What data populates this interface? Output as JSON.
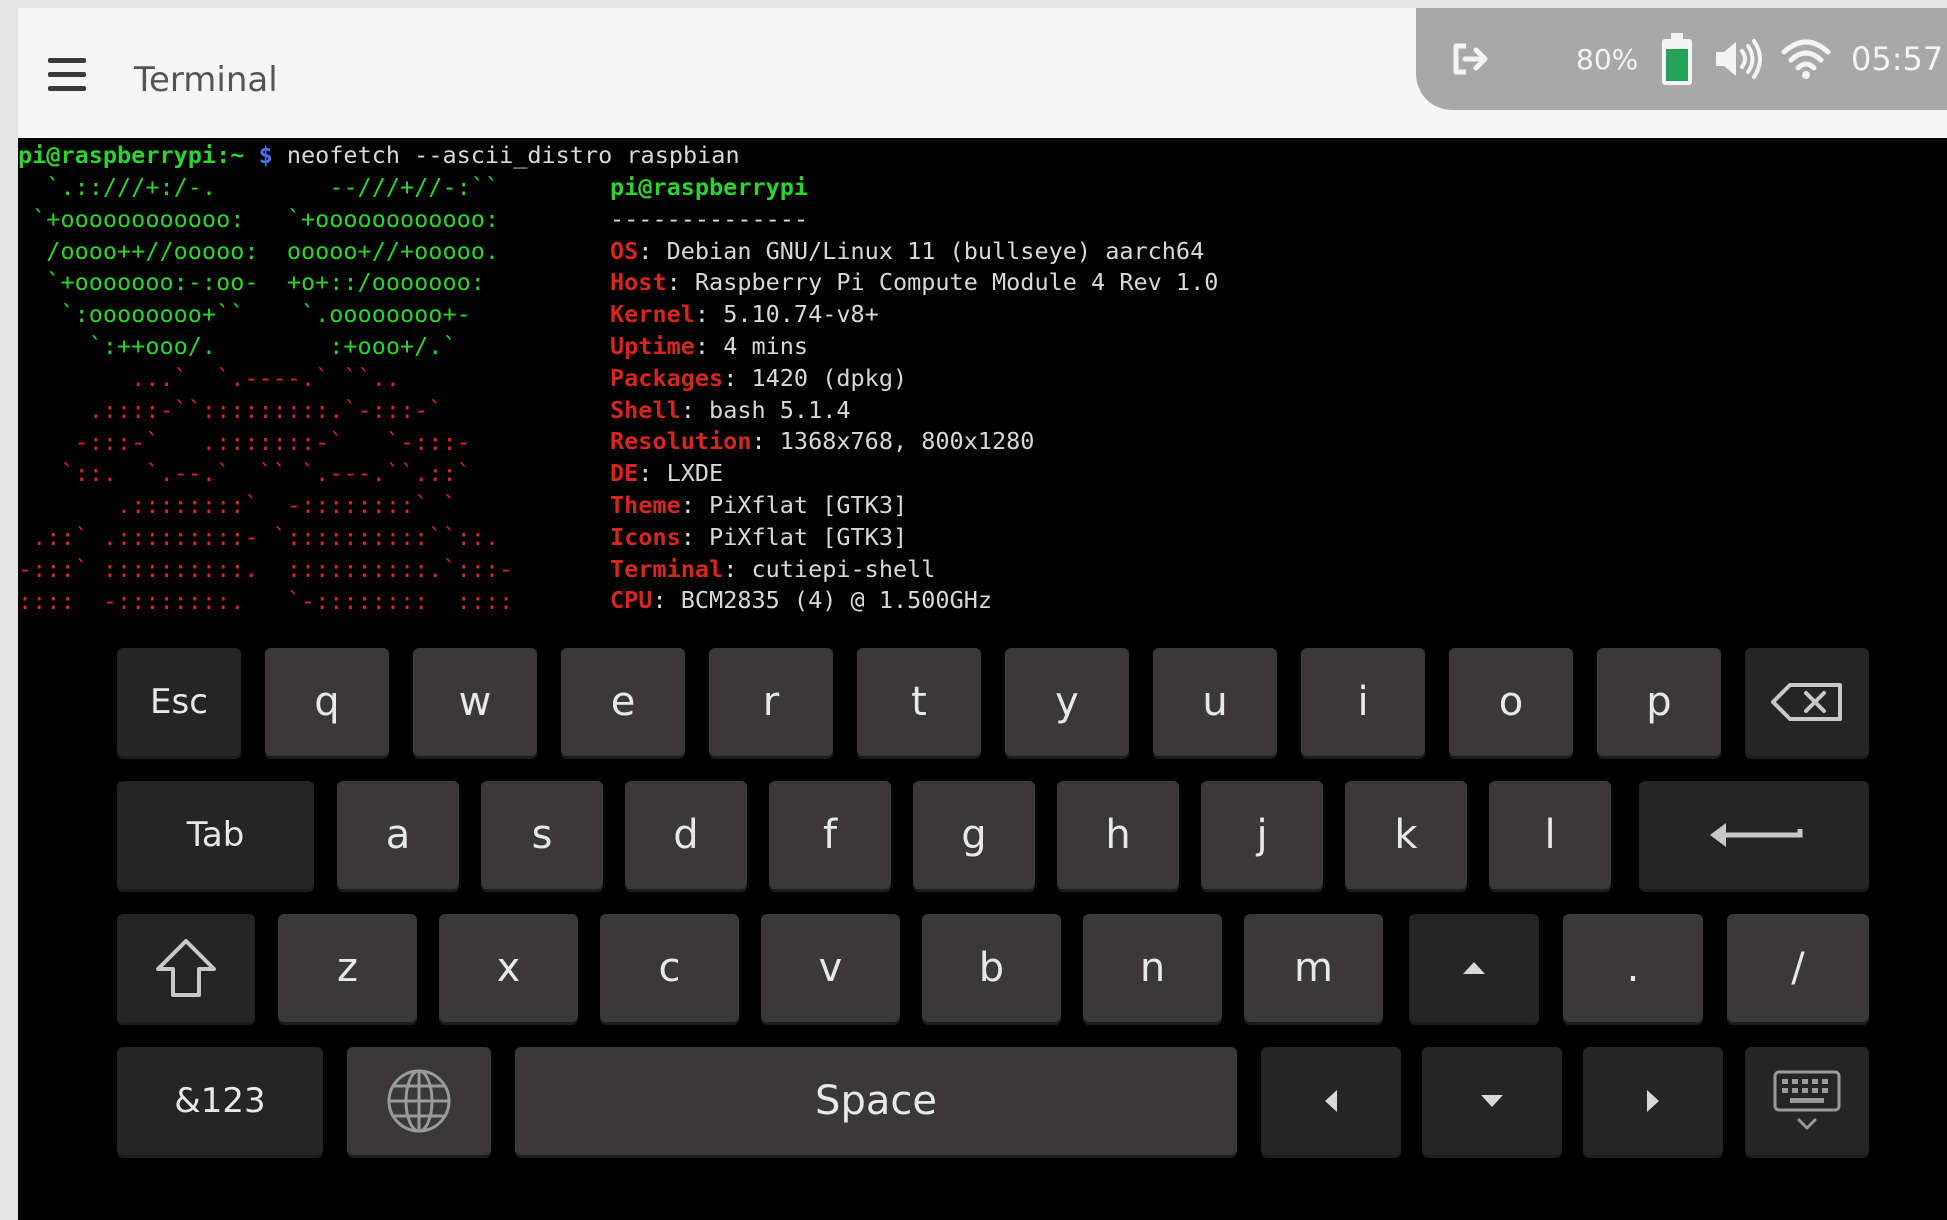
{
  "topbar": {
    "title": "Terminal",
    "menu_icon": "hamburger-menu-icon",
    "status": {
      "logout_icon": "logout-icon",
      "battery_percent": "80%",
      "battery_icon": "battery-icon",
      "volume_icon": "volume-icon",
      "wifi_icon": "wifi-icon",
      "time": "05:57"
    }
  },
  "terminal": {
    "prompt_user": "pi@raspberrypi:~",
    "prompt_symbol": "$",
    "command": "neofetch --ascii_distro raspbian",
    "logo_green": "  `.::///+:/-.        --///+//-:``\n `+oooooooooooo:   `+oooooooooooo:\n  /oooo++//ooooo:  ooooo+//+ooooo.\n  `+ooooooo:-:oo-  +o+::/ooooooo:\n   `:oooooooo+``    `.oooooooo+-\n     `:++ooo/.        :+ooo+/.`",
    "logo_red": "        ...`  `.----.` ``..\n     .::::-``:::::::::.`-:::-`\n    -:::-`   .:::::::-`   `-:::-\n   `::.  `.--.`  `` `.---.``.::`\n       .::::::::`  -::::::::` `\n .::` .:::::::::- `::::::::::``::.\n-:::` ::::::::::.  ::::::::::.`:::-\n::::  -::::::::.   `-::::::::  ::::",
    "info_header": "pi@raspberrypi",
    "info_separator": "--------------",
    "info": [
      {
        "key": "OS",
        "value": "Debian GNU/Linux 11 (bullseye) aarch64"
      },
      {
        "key": "Host",
        "value": "Raspberry Pi Compute Module 4 Rev 1.0"
      },
      {
        "key": "Kernel",
        "value": "5.10.74-v8+"
      },
      {
        "key": "Uptime",
        "value": "4 mins"
      },
      {
        "key": "Packages",
        "value": "1420 (dpkg)"
      },
      {
        "key": "Shell",
        "value": "bash 5.1.4"
      },
      {
        "key": "Resolution",
        "value": "1368x768, 800x1280"
      },
      {
        "key": "DE",
        "value": "LXDE"
      },
      {
        "key": "Theme",
        "value": "PiXflat [GTK3]"
      },
      {
        "key": "Icons",
        "value": "PiXflat [GTK3]"
      },
      {
        "key": "Terminal",
        "value": "cutiepi-shell"
      },
      {
        "key": "CPU",
        "value": "BCM2835 (4) @ 1.500GHz"
      }
    ]
  },
  "keyboard": {
    "row1": [
      "Esc",
      "q",
      "w",
      "e",
      "r",
      "t",
      "y",
      "u",
      "i",
      "o",
      "p"
    ],
    "backspace_icon": "backspace-icon",
    "row2": [
      "Tab",
      "a",
      "s",
      "d",
      "f",
      "g",
      "h",
      "j",
      "k",
      "l"
    ],
    "enter_icon": "enter-arrow-icon",
    "shift_icon": "shift-icon",
    "row3": [
      "z",
      "x",
      "c",
      "v",
      "b",
      "n",
      "m"
    ],
    "up_icon": "arrow-up-icon",
    "row3_tail": [
      ".",
      "/"
    ],
    "symbols_label": "&123",
    "globe_icon": "globe-icon",
    "space_label": "Space",
    "left_icon": "arrow-left-icon",
    "down_icon": "arrow-down-icon",
    "right_icon": "arrow-right-icon",
    "hide_keyboard_icon": "hide-keyboard-icon"
  }
}
